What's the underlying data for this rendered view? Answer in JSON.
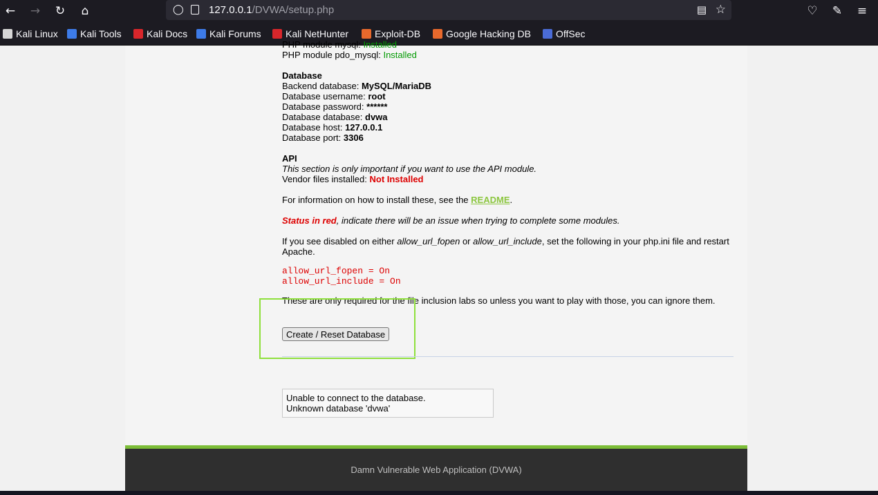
{
  "browser": {
    "url_host": "127.0.0.1",
    "url_path": "/DVWA/setup.php",
    "icons": [
      "back-icon",
      "forward-icon",
      "reload-icon",
      "home-icon",
      "shield-icon",
      "reader-view-icon",
      "star-icon",
      "pocket-icon",
      "extensions-icon",
      "menu-icon"
    ]
  },
  "bookmarks": [
    {
      "label": "Kali Linux",
      "color": "#d6d6d6"
    },
    {
      "label": "Kali Tools",
      "color": "#3d7be8"
    },
    {
      "label": "Kali Docs",
      "color": "#d9262b"
    },
    {
      "label": "Kali Forums",
      "color": "#3d7be8"
    },
    {
      "label": "Kali NetHunter",
      "color": "#d9262b"
    },
    {
      "label": "Exploit-DB",
      "color": "#e8692c"
    },
    {
      "label": "Google Hacking DB",
      "color": "#e8692c"
    },
    {
      "label": "OffSec",
      "color": "#4a6bd6"
    }
  ],
  "php": {
    "mysql_label": "PHP module mysql:",
    "mysql_status": "Installed",
    "pdo_label": "PHP module pdo_mysql:",
    "pdo_status": "Installed"
  },
  "database": {
    "heading": "Database",
    "backend_label": "Backend database:",
    "backend_value": "MySQL/MariaDB",
    "username_label": "Database username:",
    "username_value": "root",
    "password_label": "Database password:",
    "password_value": "******",
    "database_label": "Database database:",
    "database_value": "dvwa",
    "host_label": "Database host:",
    "host_value": "127.0.0.1",
    "port_label": "Database port:",
    "port_value": "3306"
  },
  "api": {
    "heading": "API",
    "note": "This section is only important if you want to use the API module.",
    "vendor_label": "Vendor files installed:",
    "vendor_status": "Not Installed"
  },
  "info": {
    "readme_prefix": "For information on how to install these, see the",
    "readme_link": "README",
    "readme_suffix": ".",
    "status_red": "Status in red",
    "status_rest": ", indicate there will be an issue when trying to complete some modules.",
    "disabled_prefix": "If you see disabled on either",
    "opt1": "allow_url_fopen",
    "or": "or",
    "opt2": "allow_url_include",
    "disabled_suffix": ", set the following in your php.ini file and restart",
    "disabled_line2": "Apache.",
    "code1": "allow_url_fopen = On",
    "code2": "allow_url_include = On",
    "only_required": "These are only required for the file inclusion labs so unless you want to play with those, you can ignore them."
  },
  "button": {
    "label": "Create / Reset Database"
  },
  "message": {
    "line1": "Unable to connect to the database.",
    "line2": "Unknown database 'dvwa'"
  },
  "footer": {
    "text": "Damn Vulnerable Web Application (DVWA)"
  },
  "colors": {
    "installed": "#009900",
    "not_installed": "#dd0000",
    "link": "#8cc63f",
    "footer_bar": "#7cbd37",
    "highlight": "#8ee03b"
  }
}
